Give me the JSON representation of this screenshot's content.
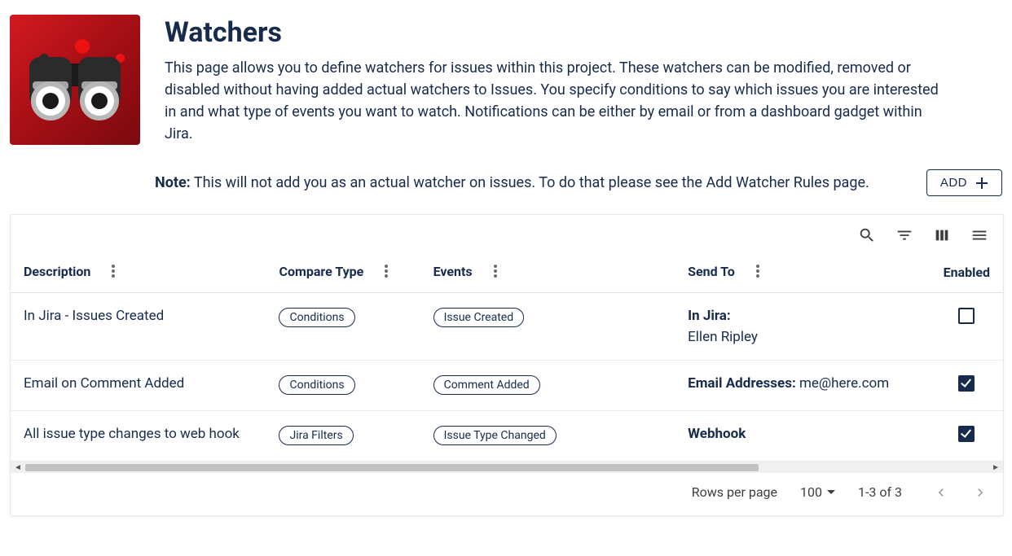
{
  "header": {
    "title": "Watchers",
    "description": "This page allows you to define watchers for issues within this project. These watchers can be modified, removed or disabled without having added actual watchers to Issues. You specify conditions to say which issues you are interested in and what type of events you want to watch. Notifications can be either by email or from a dashboard gadget within Jira.",
    "note_label": "Note:",
    "note_text": "This will not add you as an actual watcher on issues. To do that please see the Add Watcher Rules page.",
    "add_button": "ADD"
  },
  "table": {
    "columns": {
      "description": "Description",
      "compare_type": "Compare Type",
      "events": "Events",
      "send_to": "Send To",
      "enabled": "Enabled"
    },
    "rows": [
      {
        "description": "In Jira - Issues Created",
        "compare_type": "Conditions",
        "event": "Issue Created",
        "send_to_label": "In Jira:",
        "send_to_value": "Ellen Ripley",
        "send_to_inline": false,
        "enabled": false
      },
      {
        "description": "Email on Comment Added",
        "compare_type": "Conditions",
        "event": "Comment Added",
        "send_to_label": "Email Addresses:",
        "send_to_value": "me@here.com",
        "send_to_inline": true,
        "enabled": true
      },
      {
        "description": "All issue type changes to web hook",
        "compare_type": "Jira Filters",
        "event": "Issue Type Changed",
        "send_to_label": "Webhook",
        "send_to_value": "",
        "send_to_inline": true,
        "enabled": true
      }
    ]
  },
  "footer": {
    "rows_per_page_label": "Rows per page",
    "rows_per_page_value": "100",
    "range": "1-3 of 3"
  }
}
